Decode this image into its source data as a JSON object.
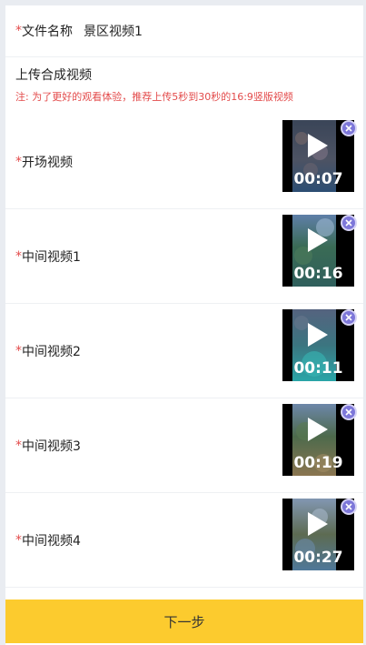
{
  "file_name": {
    "required_mark": "*",
    "label": "文件名称",
    "value": "景区视频1"
  },
  "upload": {
    "title": "上传合成视频",
    "note": "注: 为了更好的观看体验，推荐上传5秒到30秒的16:9竖版视频"
  },
  "videos": [
    {
      "required_mark": "*",
      "label": "开场视频",
      "duration": "00:07",
      "play_icon": "play-icon",
      "remove_icon": "remove-icon"
    },
    {
      "required_mark": "*",
      "label": "中间视频1",
      "duration": "00:16",
      "play_icon": "play-icon",
      "remove_icon": "remove-icon"
    },
    {
      "required_mark": "*",
      "label": "中间视频2",
      "duration": "00:11",
      "play_icon": "play-icon",
      "remove_icon": "remove-icon"
    },
    {
      "required_mark": "*",
      "label": "中间视频3",
      "duration": "00:19",
      "play_icon": "play-icon",
      "remove_icon": "remove-icon"
    },
    {
      "required_mark": "*",
      "label": "中间视频4",
      "duration": "00:27",
      "play_icon": "play-icon",
      "remove_icon": "remove-icon"
    }
  ],
  "next_button": {
    "label": "下一步"
  },
  "colors": {
    "accent": "#fccb2e",
    "required": "#e34b4b",
    "remove_icon": "#7d77d9"
  }
}
